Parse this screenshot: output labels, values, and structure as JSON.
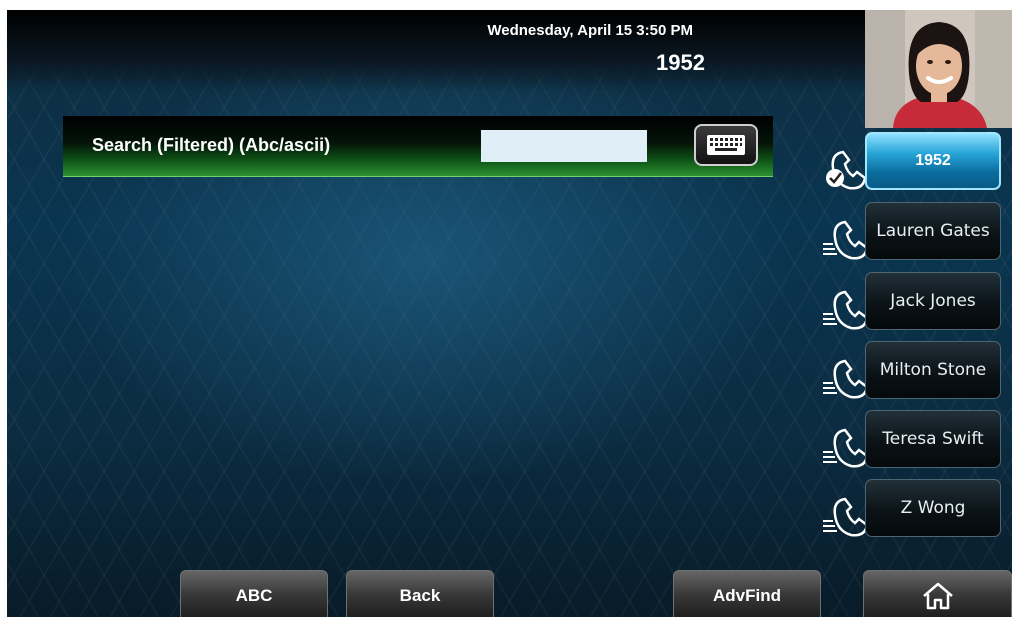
{
  "status": {
    "datetime": "Wednesday, April 15  3:50 PM",
    "line_number": "1952"
  },
  "search": {
    "label": "Search (Filtered) (Abc/ascii)",
    "value": "",
    "placeholder": ""
  },
  "lines": [
    {
      "label": "1952",
      "state": "registered",
      "active": true
    },
    {
      "label": "Lauren Gates"
    },
    {
      "label": "Jack Jones"
    },
    {
      "label": "Milton Stone"
    },
    {
      "label": "Teresa Swift"
    },
    {
      "label": "Z Wong"
    }
  ],
  "softkeys": {
    "abc": "ABC",
    "back": "Back",
    "advfind": "AdvFind"
  },
  "icons": {
    "keyboard": "keyboard-icon",
    "phone": "phone-handset-icon",
    "home": "home-icon"
  },
  "colors": {
    "accent": "#2aa6d8",
    "search_bar": "#2d9130"
  }
}
